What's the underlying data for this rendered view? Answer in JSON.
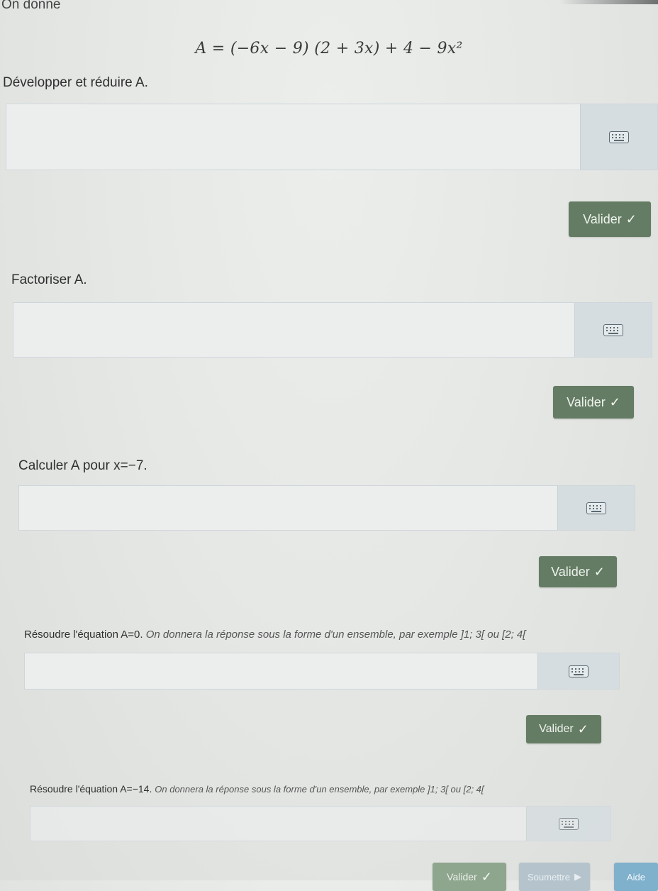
{
  "intro": "On donne",
  "formula": "A = (−6x − 9) (2 + 3x) + 4 − 9x²",
  "questions": [
    {
      "prompt": "Développer et réduire A.",
      "prompt_italic": "",
      "value": "",
      "validate_label": "Valider"
    },
    {
      "prompt": "Factoriser A.",
      "prompt_italic": "",
      "value": "",
      "validate_label": "Valider"
    },
    {
      "prompt": "Calculer A pour x=−7.",
      "prompt_italic": "",
      "value": "",
      "validate_label": "Valider"
    },
    {
      "prompt": "Résoudre l'équation A=0.",
      "prompt_italic": "On donnera la réponse sous la forme d'un ensemble, par exemple ]1; 3[ ou [2; 4[",
      "value": "",
      "validate_label": "Valider"
    },
    {
      "prompt": "Résoudre l'équation A=−14.",
      "prompt_italic": "On donnera la réponse sous la forme d'un ensemble, par exemple ]1; 3[ ou [2; 4[",
      "value": "",
      "validate_label": "Valider"
    }
  ],
  "footer": {
    "submit_label": "Soumettre",
    "help_label": "Aide"
  },
  "colors": {
    "validate_button": "#647c63",
    "keyboard_panel": "#d5dde1",
    "help_button": "#7fb0cc"
  },
  "icons": {
    "keyboard": "keyboard-icon",
    "check": "check-icon"
  }
}
